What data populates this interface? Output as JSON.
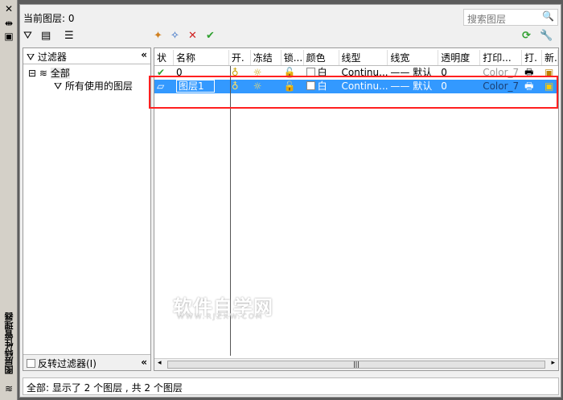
{
  "palette": {
    "title": "图层特性管理器"
  },
  "header": {
    "current_layer": "当前图层: 0",
    "search_placeholder": "搜索图层"
  },
  "filters": {
    "title": "过滤器",
    "all": "全部",
    "used": "所有使用的图层",
    "invert": "反转过滤器(I)"
  },
  "columns": [
    "状",
    "名称",
    "开.",
    "冻结",
    "锁...",
    "颜色",
    "线型",
    "线宽",
    "透明度",
    "打印...",
    "打.",
    "新."
  ],
  "rows": [
    {
      "status": "✔",
      "name": "0",
      "on": "💡",
      "freeze": "☼",
      "lock": "🔓",
      "color": "白",
      "linetype": "Continu...",
      "lineweight": "—— 默认",
      "transparency": "0",
      "plotstyle": "Color_7",
      "plot": "🖶",
      "newvp": "▣"
    },
    {
      "status": "▱",
      "name": "图层1",
      "on": "💡",
      "freeze": "☼",
      "lock": "🔓",
      "color": "白",
      "linetype": "Continu...",
      "lineweight": "—— 默认",
      "transparency": "0",
      "plotstyle": "Color_7",
      "plot": "🖶",
      "newvp": "▣"
    }
  ],
  "watermark": {
    "cn": "软件自学网",
    "en": "WWW.RJZXW.COM"
  },
  "status": "全部: 显示了 2 个图层 , 共 2 个图层"
}
